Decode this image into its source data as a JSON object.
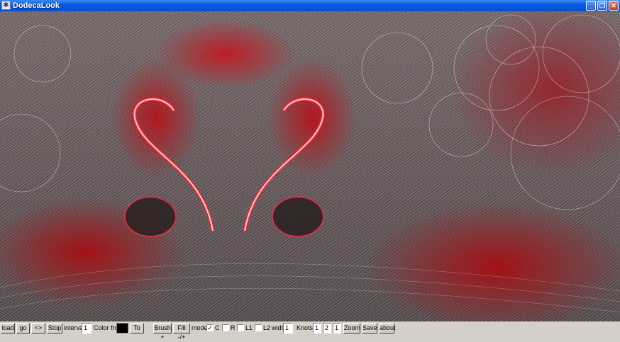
{
  "window": {
    "title": "DodecaLook",
    "minimize_glyph": "_",
    "maximize_glyph": "❐",
    "close_glyph": "✕",
    "app_icon": "grid-icon"
  },
  "colors": {
    "titlebar": "#0a5ae0",
    "canvas_red": "#be0a14",
    "canvas_white": "#ffffff",
    "swatch": "#000000"
  },
  "toolbar": {
    "load": "load",
    "go": "go",
    "swap": "<>",
    "stop": "Stop",
    "interval_label": "interval",
    "interval_value": "1",
    "color_from_label": "Color from",
    "to": "To",
    "brush": "Brush +",
    "fill": "Fill -/+",
    "mode_label": "mode",
    "c_label": "C",
    "c_checked": "✓",
    "r_label": "R",
    "l1_label": "L1",
    "l2_label": "L2",
    "width_label": "width",
    "width_value": "1",
    "knots_label": "Knots",
    "knot1": "1",
    "knot2": "2",
    "knot3": "1",
    "zoom": "Zoom",
    "save": "Save",
    "about": "about"
  }
}
